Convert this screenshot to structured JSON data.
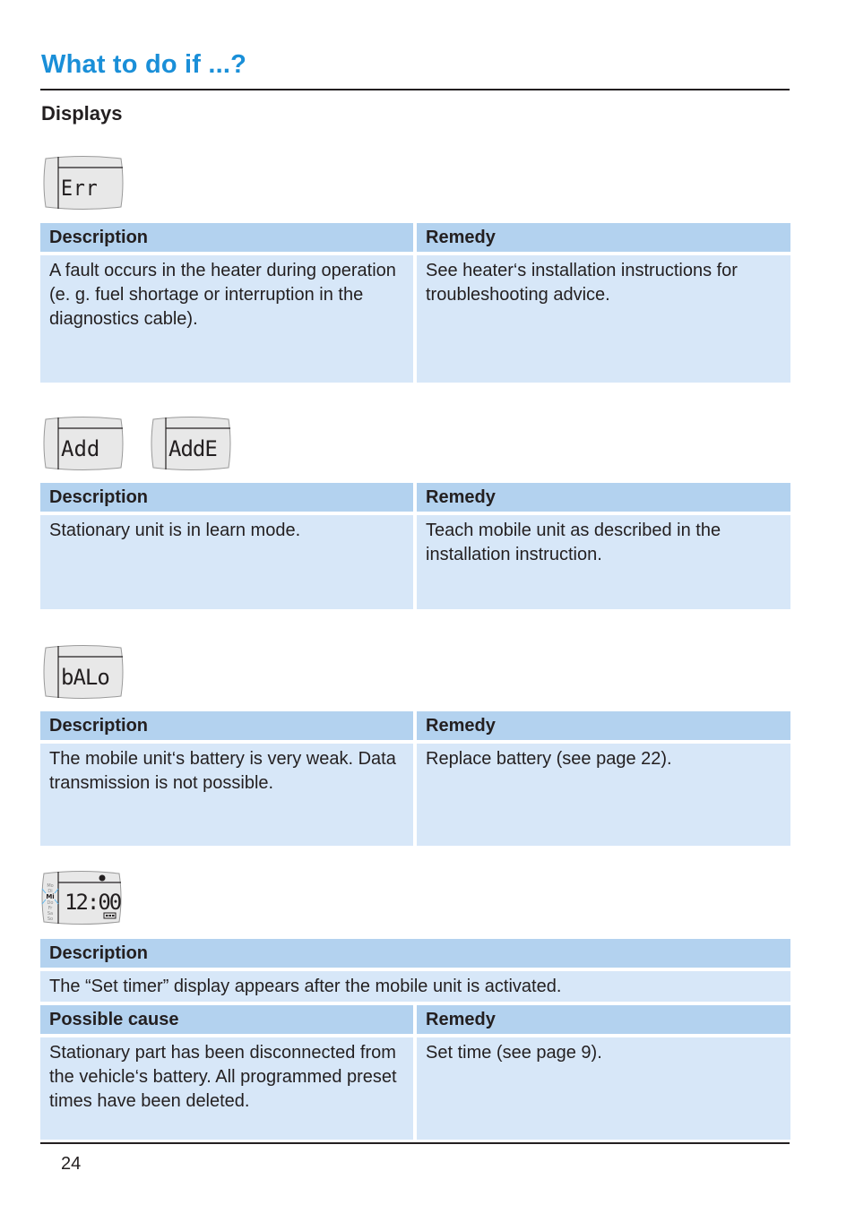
{
  "page": {
    "title": "What to do if ...?",
    "subtitle": "Displays",
    "page_number": "24"
  },
  "colors": {
    "title": "#1a8fd8",
    "header_bg": "#b3d2ef",
    "body_bg": "#d7e7f8",
    "lcd_bg": "#e8e8e8"
  },
  "sections": [
    {
      "displays": [
        "Err"
      ],
      "description_label": "Description",
      "remedy_label": "Remedy",
      "description": "A fault occurs in the heater during operation (e. g. fuel shortage or interruption in the diagnostics cable).",
      "remedy": "See heater‘s installation instructions for troubleshooting advice."
    },
    {
      "displays": [
        "Add",
        "AddE"
      ],
      "description_label": "Description",
      "remedy_label": "Remedy",
      "description": "Stationary unit is in learn mode.",
      "remedy": "Teach mobile unit as described in the installation instruction."
    },
    {
      "displays": [
        "bALo"
      ],
      "description_label": "Description",
      "remedy_label": "Remedy",
      "description": "The mobile unit‘s battery is very weak. Data transmission is not possible.",
      "remedy": "Replace battery (see page 22)."
    },
    {
      "displays": [
        "12:00"
      ],
      "display_days": [
        "Mo",
        "Di",
        "Mi",
        "Do",
        "Fr",
        "Sa",
        "So"
      ],
      "display_active_day": "Mi",
      "description_label": "Description",
      "description": "The “Set timer” display appears after the mobile unit is activated.",
      "cause_label": "Possible cause",
      "remedy_label": "Remedy",
      "cause": "Stationary part has been disconnected from the vehicle‘s battery. All programmed preset times have been deleted.",
      "remedy": "Set time (see page 9)."
    }
  ]
}
